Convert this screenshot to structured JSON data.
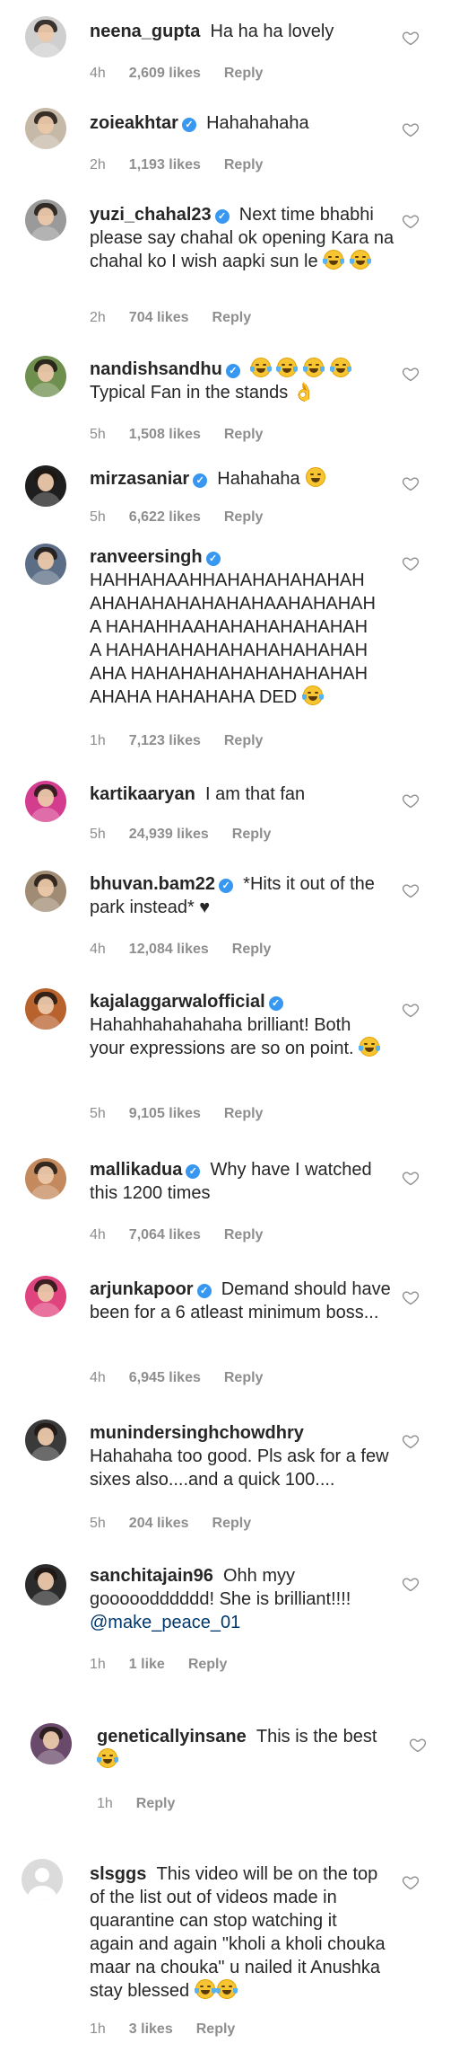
{
  "comments": [
    {
      "username": "neena_gupta",
      "verified": false,
      "text": "Ha ha ha lovely",
      "emojis": [],
      "time": "4h",
      "likes": "2,609 likes",
      "reply": "Reply"
    },
    {
      "username": "zoieakhtar",
      "verified": true,
      "text": "Hahahahaha",
      "emojis": [],
      "time": "2h",
      "likes": "1,193 likes",
      "reply": "Reply"
    },
    {
      "username": "yuzi_chahal23",
      "verified": true,
      "text": "Next time bhabhi please say chahal ok opening Kara na chahal ko I wish aapki sun le",
      "emojis": [
        "rofl",
        "rofl"
      ],
      "time": "2h",
      "likes": "704 likes",
      "reply": "Reply"
    },
    {
      "username": "nandishsandhu",
      "verified": true,
      "text": "Typical Fan in the stands",
      "emojis": [
        "joy",
        "joy",
        "joy",
        "joy",
        "ok-hand"
      ],
      "time": "5h",
      "likes": "1,508 likes",
      "reply": "Reply"
    },
    {
      "username": "mirzasaniar",
      "verified": true,
      "text": "Hahahaha",
      "emojis": [
        "sweat-smile"
      ],
      "time": "5h",
      "likes": "6,622 likes",
      "reply": "Reply"
    },
    {
      "username": "ranveersingh",
      "verified": true,
      "text": "HAHHAHAAHHAHAHAHAHAHAH AHAHAHAHAHAHAHAAHAHAHAHA HAHAHHAAHAHAHAHAHAHAHA HAHAHAHAHAHAHAHAHAHAHAHA HAHAHAHAHAHAHAHAHAHAHAHA HAHAHAHA DED",
      "emojis": [
        "joy"
      ],
      "time": "1h",
      "likes": "7,123 likes",
      "reply": "Reply"
    },
    {
      "username": "kartikaaryan",
      "verified": false,
      "text": "I am that fan",
      "emojis": [],
      "time": "5h",
      "likes": "24,939 likes",
      "reply": "Reply"
    },
    {
      "username": "bhuvan.bam22",
      "verified": true,
      "text": "*Hits it out of the park instead* ♥",
      "emojis": [],
      "time": "4h",
      "likes": "12,084 likes",
      "reply": "Reply"
    },
    {
      "username": "kajalaggarwalofficial",
      "verified": true,
      "text": "Hahahhahahahaha brilliant! Both your expressions are so on point.",
      "emojis": [
        "rofl"
      ],
      "time": "5h",
      "likes": "9,105 likes",
      "reply": "Reply"
    },
    {
      "username": "mallikadua",
      "verified": true,
      "text": "Why have I watched this 1200 times",
      "emojis": [],
      "time": "4h",
      "likes": "7,064 likes",
      "reply": "Reply"
    },
    {
      "username": "arjunkapoor",
      "verified": true,
      "text": "Demand should have been for a 6 atleast minimum boss...",
      "emojis": [],
      "time": "4h",
      "likes": "6,945 likes",
      "reply": "Reply"
    },
    {
      "username": "munindersinghchowdhry",
      "verified": false,
      "text": "Hahahaha too good. Pls ask for a few sixes also....and a quick 100....",
      "emojis": [],
      "time": "5h",
      "likes": "204 likes",
      "reply": "Reply"
    },
    {
      "username": "sanchitajain96",
      "verified": false,
      "text": "Ohh myy gooooodddddd! She is brilliant!!!!",
      "mention": "@make_peace_01",
      "emojis": [],
      "time": "1h",
      "likes": "1 like",
      "reply": "Reply"
    },
    {
      "username": "geneticallyinsane",
      "verified": false,
      "text": "This is the best",
      "emojis": [
        "rofl"
      ],
      "time": "1h",
      "likes": "",
      "reply": "Reply"
    },
    {
      "username": "slsggs",
      "verified": false,
      "text": "This video will be on the top of the list out of videos made in quarantine can stop watching it again and again \"kholi a kholi chouka maar na chouka\" u nailed it Anushka stay blessed",
      "emojis": [
        "rofl",
        "rofl"
      ],
      "time": "1h",
      "likes": "3 likes",
      "reply": "Reply"
    }
  ],
  "icons": {
    "like": "heart-outline-icon",
    "verified": "verified-badge-icon",
    "emoji": "emoji-icon"
  },
  "colors": {
    "text": "#262626",
    "meta": "#8e8e8e",
    "verified": "#3897f0",
    "mention": "#00376b"
  }
}
